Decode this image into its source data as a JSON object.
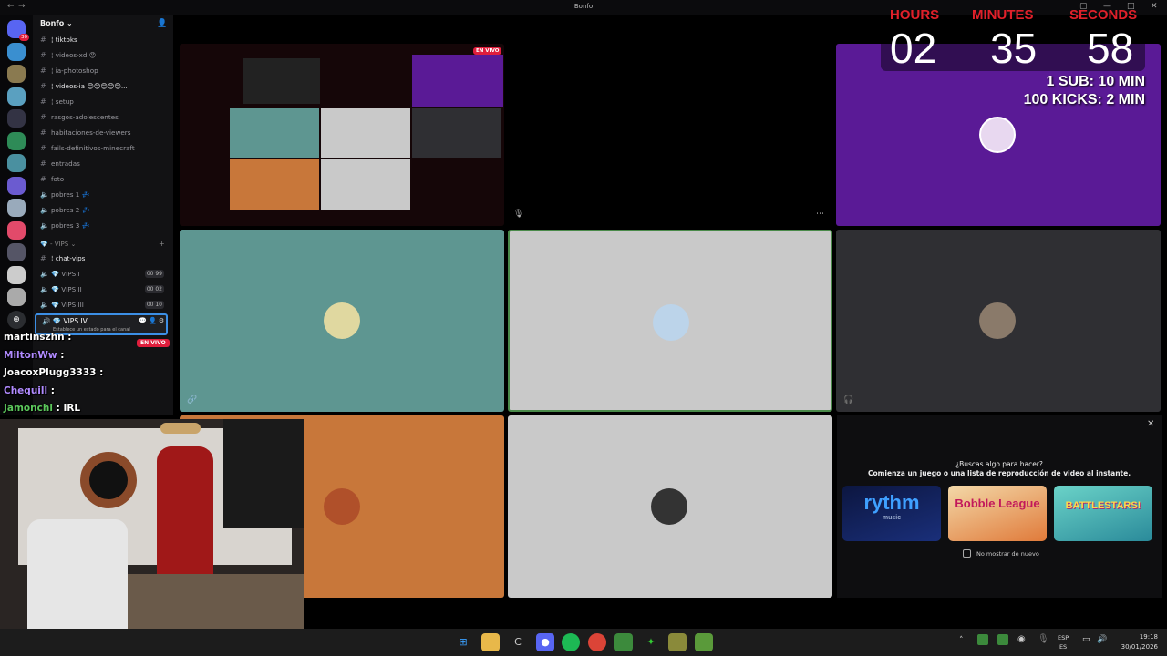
{
  "window": {
    "title": "Bonfo"
  },
  "server": {
    "name": "Bonfo"
  },
  "servers": [
    {
      "icon": "discord-logo-icon",
      "badge": "30",
      "color": "#5865f2"
    },
    {
      "icon": "server-icon",
      "color": "#3a8fd0"
    },
    {
      "icon": "server-icon",
      "color": "#8a7a50"
    },
    {
      "icon": "server-icon",
      "color": "#5aa0c0"
    },
    {
      "icon": "server-icon",
      "color": "#334"
    },
    {
      "icon": "server-icon",
      "color": "#2e8b57"
    },
    {
      "icon": "server-icon",
      "color": "#4a90a0"
    },
    {
      "icon": "server-icon",
      "color": "#6b5bd0"
    },
    {
      "icon": "server-icon",
      "color": "#9ab"
    },
    {
      "icon": "server-icon",
      "color": "#e24a6a"
    },
    {
      "icon": "server-icon",
      "color": "#556"
    },
    {
      "icon": "server-icon",
      "color": "#ccc"
    },
    {
      "icon": "server-icon",
      "color": "#aaa"
    }
  ],
  "channels": [
    {
      "type": "text",
      "name": "¦ tiktoks",
      "bright": true
    },
    {
      "type": "text",
      "name": "¦ videos-xd 😡",
      "bright": false
    },
    {
      "type": "text",
      "name": "¦ ia-photoshop",
      "bright": false
    },
    {
      "type": "text",
      "name": "¦ videos-ia 😊😊😊😊😊...",
      "bright": true
    },
    {
      "type": "text",
      "name": "¦ setup",
      "bright": false
    },
    {
      "type": "text",
      "name": "rasgos-adolescentes",
      "bright": false
    },
    {
      "type": "text",
      "name": "habitaciones-de-viewers",
      "bright": false
    },
    {
      "type": "text",
      "name": "fails-definitivos-minecraft",
      "bright": false
    },
    {
      "type": "text",
      "name": "entradas",
      "bright": false
    },
    {
      "type": "text",
      "name": "foto",
      "bright": false
    },
    {
      "type": "voice",
      "name": "pobres 1 💤",
      "bright": false
    },
    {
      "type": "voice",
      "name": "pobres 2 💤",
      "bright": false
    },
    {
      "type": "voice",
      "name": "pobres 3 💤",
      "bright": false
    }
  ],
  "vips_category": "- VIPS",
  "vips_channels": [
    {
      "type": "text",
      "name": "¦ chat-vips",
      "bright": true
    },
    {
      "type": "voice",
      "name": "💎 VIPS I",
      "count": "00 99"
    },
    {
      "type": "voice",
      "name": "💎 VIPS II",
      "count": "00 02"
    },
    {
      "type": "voice",
      "name": "💎 VIPS III",
      "count": "00 10"
    }
  ],
  "selected_channel": {
    "name": "💎 VIPS IV",
    "status": "Establece un estado para el canal"
  },
  "live_badge": "EN VIVO",
  "chat": [
    {
      "user": "martinszhn",
      "text": "",
      "color": "#ffffff"
    },
    {
      "user": "MiltonWw",
      "text": "",
      "color": "#b08aff"
    },
    {
      "user": "JoacoxPlugg3333",
      "text": "",
      "color": "#ffffff"
    },
    {
      "user": "Chequill",
      "text": "",
      "color": "#b08aff"
    },
    {
      "user": "Jamonchi",
      "text": "IRL",
      "color": "#5cc85c"
    }
  ],
  "timer": {
    "hours_label": "HOURS",
    "minutes_label": "MINUTES",
    "seconds_label": "SECONDS",
    "hours": "02",
    "minutes": "35",
    "seconds": "58",
    "rule1": "1 SUB: 10 MIN",
    "rule2": "100 KICKS: 2 MIN"
  },
  "activity": {
    "title": "¿Buscas algo para hacer?",
    "subtitle": "Comienza un juego o una lista de reproducción de video al instante.",
    "games": [
      {
        "name": "rythm",
        "sub": "music"
      },
      {
        "name": "Bobble League",
        "sub": ""
      },
      {
        "name": "BATTLESTARS!",
        "sub": ""
      }
    ],
    "checkbox_label": "No mostrar de nuevo"
  },
  "tile_colors": {
    "teal": "#5e9691",
    "grey": "#c9c9c9",
    "dark": "#2f2f33",
    "orange": "#c8773a",
    "purple": "#5a1a96"
  },
  "taskbar": {
    "lang1": "ESP",
    "lang2": "ES",
    "time": "19:18",
    "date": "30/01/2026"
  }
}
